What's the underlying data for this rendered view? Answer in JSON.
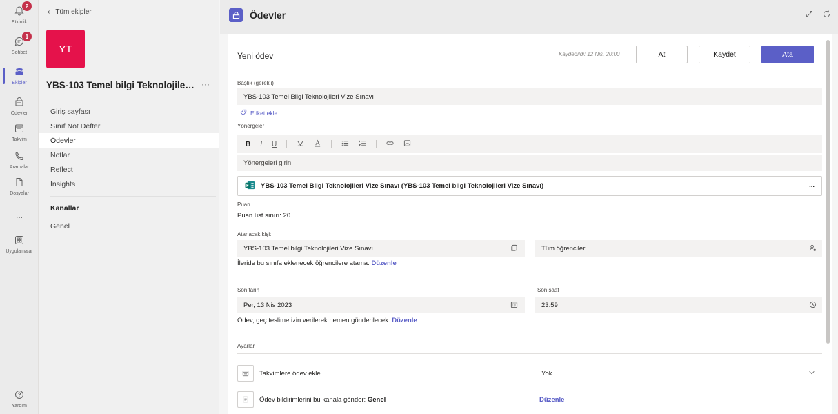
{
  "rail": {
    "items": [
      {
        "label": "Etkinlik",
        "icon": "bell-icon",
        "badge": "2"
      },
      {
        "label": "Sohbet",
        "icon": "chat-icon",
        "badge": "1"
      },
      {
        "label": "Ekipler",
        "icon": "teams-icon"
      },
      {
        "label": "Ödevler",
        "icon": "assignments-icon"
      },
      {
        "label": "Takvim",
        "icon": "calendar-icon"
      },
      {
        "label": "Aramalar",
        "icon": "phone-icon"
      },
      {
        "label": "Dosyalar",
        "icon": "file-icon"
      },
      {
        "label": "...",
        "icon": "more-icon"
      },
      {
        "label": "Uygulamalar",
        "icon": "apps-icon"
      },
      {
        "label": "Yardım",
        "icon": "help-icon"
      }
    ]
  },
  "team": {
    "back_label": "Tüm ekipler",
    "avatar_initials": "YT",
    "avatar_color": "#e5124b",
    "name": "YBS-103 Temel bilgi Teknolojileri Vize Sınavı",
    "nav": [
      "Giriş sayfası",
      "Sınıf Not Defteri",
      "Ödevler",
      "Notlar",
      "Reflect",
      "Insights"
    ],
    "channels_heading": "Kanallar",
    "channels": [
      "Genel"
    ]
  },
  "header": {
    "title": "Ödevler",
    "accent": "#5b5fc7"
  },
  "form": {
    "heading": "Yeni ödev",
    "saved_text": "Kaydedildi: 12 Nis, 20:00",
    "discard_label": "At",
    "save_label": "Kaydet",
    "assign_label": "Ata",
    "title_label": "Başlık (gerekli)",
    "title_value": "YBS-103 Temel Bilgi Teknolojileri Vize Sınavı",
    "tag_label": "Etiket ekle",
    "instructions_label": "Yönergeler",
    "instructions_placeholder": "Yönergeleri girin",
    "toolbar": [
      "B",
      "I",
      "U",
      "highlight",
      "font-color",
      "bullets",
      "numbering",
      "link",
      "image"
    ],
    "attachment": "YBS-103 Temel Bilgi Teknolojileri Vize Sınavı (YBS-103 Temel bilgi Teknolojileri Vize Sınavı)",
    "attachment_more": "...",
    "points_label": "Puan",
    "points_value": "Puan üst sınırı: 20",
    "assign_to_label": "Atanacak kişi:",
    "assign_class": "YBS-103 Temel bilgi Teknolojileri Vize Sınavı",
    "assign_students": "Tüm öğrenciler",
    "future_students_text": "İleride bu sınıfa eklenecek öğrencilere atama.",
    "edit_label": "Düzenle",
    "due_date_label": "Son tarih",
    "due_date_value": "Per, 13 Nis 2023",
    "due_time_label": "Son saat",
    "due_time_value": "23:59",
    "late_text": "Ödev, geç teslime izin verilerek hemen gönderilecek.",
    "settings_label": "Ayarlar",
    "calendar_text": "Takvimlere ödev ekle",
    "calendar_value": "Yok",
    "notify_text": "Ödev bildirimlerini bu kanala gönder:",
    "notify_channel": "Genel"
  }
}
